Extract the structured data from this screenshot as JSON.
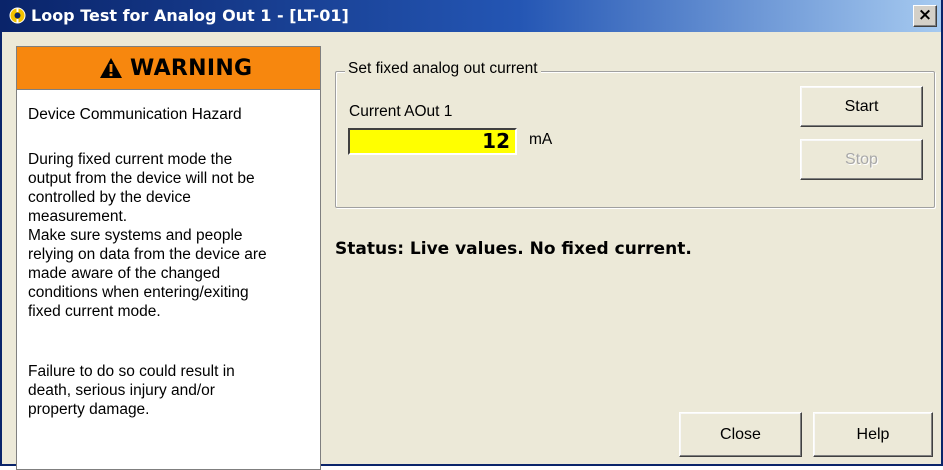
{
  "window": {
    "title": "Loop Test for Analog Out 1 - [LT-01]",
    "close_glyph": "×"
  },
  "warning": {
    "title": "WARNING",
    "heading": "Device Communication Hazard",
    "body": "During fixed current mode the output from the device will not be controlled by the device measurement. Make sure systems and people relying on data from the device are made aware of the changed conditions when entering/exiting fixed current mode.",
    "body_lines": [
      "During fixed current mode the",
      "output from the device will not be",
      "controlled by the device",
      "measurement.",
      "Make sure systems and people",
      "relying on data from the device are",
      "made aware of the changed",
      "conditions when entering/exiting",
      "fixed current mode."
    ],
    "footer_lines": [
      "Failure to do so could result in",
      "death, serious injury and/or",
      "property damage."
    ],
    "icon": "warning-triangle-icon",
    "header_color": "#f7870e"
  },
  "group": {
    "legend": "Set fixed analog out current",
    "field_label": "Current AOut 1",
    "current_value": "12",
    "unit": "mA",
    "input_color": "#ffff00"
  },
  "buttons": {
    "start": "Start",
    "stop": "Stop",
    "close": "Close",
    "help": "Help"
  },
  "status": "Status: Live values. No fixed current."
}
